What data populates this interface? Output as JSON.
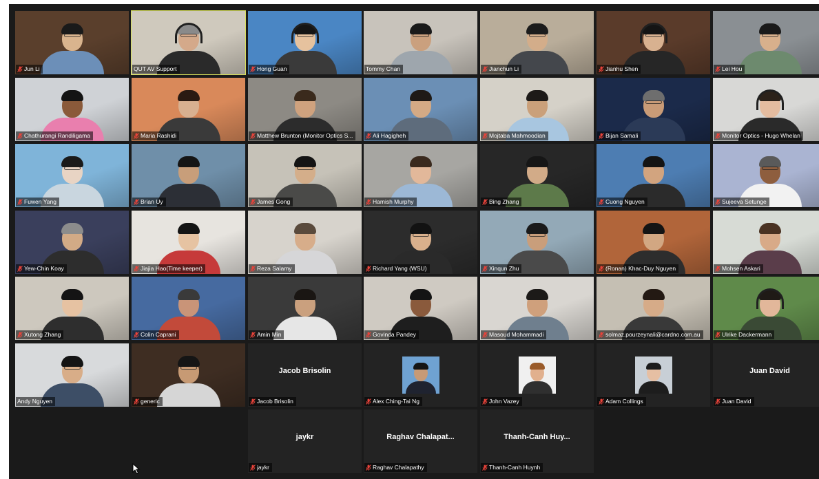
{
  "participants": [
    {
      "name": "Jun Li",
      "muted": true,
      "bg": "#5a3f2c",
      "skin": "#d9b48e",
      "hair": "#1a1a1a",
      "shirt": "#6c8fb8",
      "glasses": true
    },
    {
      "name": "QUT AV Support",
      "muted": false,
      "bg": "#cfc9bd",
      "skin": "#d4a98a",
      "hair": "#8a8a8a",
      "shirt": "#2a2a2a",
      "glasses": true,
      "headset": true,
      "active": true
    },
    {
      "name": "Hong Guan",
      "muted": true,
      "bg": "#4a86c4",
      "skin": "#e6c29e",
      "hair": "#151515",
      "shirt": "#3a3a3a",
      "glasses": true,
      "headset": true
    },
    {
      "name": "Tommy Chan",
      "muted": false,
      "bg": "#c8c3bb",
      "skin": "#caa07e",
      "hair": "#1a1a1a",
      "shirt": "#9ea6ad",
      "glasses": true
    },
    {
      "name": "Jianchun Li",
      "muted": true,
      "bg": "#b9ad9a",
      "skin": "#d3ad8a",
      "hair": "#1c1c1c",
      "shirt": "#44474c",
      "glasses": true
    },
    {
      "name": "Jianhu Shen",
      "muted": true,
      "bg": "#5a3b2a",
      "skin": "#d8b190",
      "hair": "#141414",
      "shirt": "#262626",
      "glasses": true,
      "headset": true
    },
    {
      "name": "Lei Hou",
      "muted": true,
      "bg": "#8a8f93",
      "skin": "#d8b08c",
      "hair": "#1a1a1a",
      "shirt": "#6d8a6e",
      "glasses": true
    },
    {
      "name": "Chathurangi Randiligama",
      "muted": true,
      "bg": "#cfd2d6",
      "skin": "#8a5a3a",
      "hair": "#141414",
      "shirt": "#e97fae",
      "glasses": false
    },
    {
      "name": "Maria Rashidi",
      "muted": true,
      "bg": "#d9895a",
      "skin": "#d8b090",
      "hair": "#2a1a12",
      "shirt": "#3a3a3a",
      "glasses": false
    },
    {
      "name": "Matthew Brunton (Monitor Optics S...",
      "muted": true,
      "bg": "#8d8a84",
      "skin": "#cfa27e",
      "hair": "#3a2a1c",
      "shirt": "#2c2c2c",
      "glasses": false
    },
    {
      "name": "Ali Hagigheh",
      "muted": true,
      "bg": "#6b8fb5",
      "skin": "#d4aa85",
      "hair": "#1f1a16",
      "shirt": "#5e6c7c",
      "glasses": false
    },
    {
      "name": "Mojtaba Mahmoodian",
      "muted": true,
      "bg": "#d5d1c8",
      "skin": "#caa07a",
      "hair": "#1d1a18",
      "shirt": "#a8c6e0",
      "glasses": false
    },
    {
      "name": "Bijan Samali",
      "muted": true,
      "bg": "#1b2a4a",
      "skin": "#c99b77",
      "hair": "#6e6e6e",
      "shirt": "#2b3a57",
      "glasses": true
    },
    {
      "name": "Monitor Optics - Hugo Whelan",
      "muted": true,
      "bg": "#d8d8d6",
      "skin": "#e4bca0",
      "hair": "#2c221a",
      "shirt": "#2a2a2a",
      "glasses": false,
      "headset": true
    },
    {
      "name": "Fuwen Yang",
      "muted": true,
      "bg": "#7fb4d9",
      "skin": "#e8d4c4",
      "hair": "#1a1a1a",
      "shirt": "#c9d6df",
      "glasses": true
    },
    {
      "name": "Brian Uy",
      "muted": true,
      "bg": "#6f8fa9",
      "skin": "#c89e7a",
      "hair": "#151515",
      "shirt": "#2c2f36",
      "glasses": false
    },
    {
      "name": "James Gong",
      "muted": true,
      "bg": "#c6c2b8",
      "skin": "#d4ae8a",
      "hair": "#141414",
      "shirt": "#4a4a48",
      "glasses": true
    },
    {
      "name": "Hamish Murphy",
      "muted": true,
      "bg": "#a7a6a2",
      "skin": "#e2b89a",
      "hair": "#3a2a1e",
      "shirt": "#9cb8d6",
      "glasses": false
    },
    {
      "name": "Bing Zhang",
      "muted": true,
      "bg": "#272727",
      "skin": "#d2ab88",
      "hair": "#161616",
      "shirt": "#5d7a4a",
      "glasses": false
    },
    {
      "name": "Cuong Nguyen",
      "muted": true,
      "bg": "#4d7db2",
      "skin": "#d2a47f",
      "hair": "#141414",
      "shirt": "#2b2b2b",
      "glasses": false
    },
    {
      "name": "Sujeeva Setunge",
      "muted": true,
      "bg": "#aab4d2",
      "skin": "#8e5e3e",
      "hair": "#5a5a5a",
      "shirt": "#f2f2f2",
      "glasses": true
    },
    {
      "name": "Yew-Chin Koay",
      "muted": true,
      "bg": "#3a3f5c",
      "skin": "#d2aa86",
      "hair": "#8c8c8c",
      "shirt": "#2d2d2d",
      "glasses": false
    },
    {
      "name": "Jiajia Hao(Time keeper)",
      "muted": true,
      "bg": "#e7e4df",
      "skin": "#e6c3a2",
      "hair": "#141414",
      "shirt": "#c63a3a",
      "glasses": false
    },
    {
      "name": "Reza Salamy",
      "muted": true,
      "bg": "#d7d3cc",
      "skin": "#d7ad8a",
      "hair": "#5a4a3c",
      "shirt": "#d6d6d8",
      "glasses": false
    },
    {
      "name": "Richard Yang (WSU)",
      "muted": true,
      "bg": "#2c2c2c",
      "skin": "#d9b08c",
      "hair": "#121212",
      "shirt": "#2a2a2a",
      "glasses": true
    },
    {
      "name": "Xinqun Zhu",
      "muted": true,
      "bg": "#93a9b7",
      "skin": "#c99e7b",
      "hair": "#1a1a1a",
      "shirt": "#4a4a4a",
      "glasses": true
    },
    {
      "name": "(Ronan) Khac-Duy Nguyen",
      "muted": true,
      "bg": "#b1653a",
      "skin": "#d2a782",
      "hair": "#141414",
      "shirt": "#2d2d2d",
      "glasses": false
    },
    {
      "name": "Mohsen Askari",
      "muted": true,
      "bg": "#d7dbd5",
      "skin": "#d8aa88",
      "hair": "#4a3222",
      "shirt": "#5a3d4a",
      "glasses": false
    },
    {
      "name": "Xutong Zhang",
      "muted": true,
      "bg": "#cdc8be",
      "skin": "#e6c2a2",
      "hair": "#141414",
      "shirt": "#2e2e2e",
      "glasses": false
    },
    {
      "name": "Colin Caprani",
      "muted": true,
      "bg": "#466aa0",
      "skin": "#c99478",
      "hair": "#3a3a3a",
      "shirt": "#c24a3a",
      "glasses": false
    },
    {
      "name": "Amin Min",
      "muted": true,
      "bg": "#3a3a3a",
      "skin": "#caa07e",
      "hair": "#1a1613",
      "shirt": "#e6e6e6",
      "glasses": false
    },
    {
      "name": "Govinda Pandey",
      "muted": true,
      "bg": "#cfcac2",
      "skin": "#8a5a3c",
      "hair": "#141414",
      "shirt": "#1e1e1e",
      "glasses": false
    },
    {
      "name": "Masoud Mohammadi",
      "muted": true,
      "bg": "#d9d6d1",
      "skin": "#cfa07c",
      "hair": "#1c1a18",
      "shirt": "#6f7f8e",
      "glasses": false
    },
    {
      "name": "solmaz.pourzeynali@cardno.com.au",
      "muted": true,
      "bg": "#c5bfb3",
      "skin": "#d6ab88",
      "hair": "#231913",
      "shirt": "#393939",
      "glasses": false
    },
    {
      "name": "Ulrike Dackermann",
      "muted": true,
      "bg": "#5f8a4a",
      "skin": "#e2b79a",
      "hair": "#1f1a16",
      "shirt": "#3a4a35",
      "glasses": false,
      "headset": true
    },
    {
      "name": "Andy Nguyen",
      "muted": false,
      "bg": "#d8dadc",
      "skin": "#d8ad88",
      "hair": "#141414",
      "shirt": "#3d4e66",
      "glasses": true
    },
    {
      "name": "generic",
      "muted": true,
      "bg": "#3e2d22",
      "skin": "#c79a74",
      "hair": "#151515",
      "shirt": "#d6d6d6",
      "glasses": true
    },
    {
      "name": "Jacob Brisolin",
      "muted": true,
      "display": "Jacob Brisolin",
      "type": "name"
    },
    {
      "name": "Alex Ching-Tai Ng",
      "muted": true,
      "type": "avatar",
      "avatar_bg": "#6fa2d2",
      "skin": "#c79a76",
      "hair": "#151515",
      "shirt": "#1f2330"
    },
    {
      "name": "John Vazey",
      "muted": true,
      "type": "avatar",
      "avatar_bg": "#f0f0f0",
      "skin": "#e1b08e",
      "hair": "#9a5b2a",
      "shirt": "#2f2f2f"
    },
    {
      "name": "Adam Collings",
      "muted": true,
      "type": "avatar",
      "avatar_bg": "#c8cfd6",
      "skin": "#e6bfa3",
      "hair": "#1c1c1c",
      "shirt": "#1d1d1d"
    },
    {
      "name": "Juan David",
      "muted": true,
      "display": "Juan David",
      "type": "name"
    },
    {
      "name": "jaykr",
      "muted": true,
      "display": "jaykr",
      "type": "name"
    },
    {
      "name": "Raghav Chalapathy",
      "muted": true,
      "display": "Raghav Chalapat...",
      "type": "name"
    },
    {
      "name": "Thanh-Canh Huynh",
      "muted": true,
      "display": "Thanh-Canh Huy...",
      "type": "name"
    }
  ]
}
